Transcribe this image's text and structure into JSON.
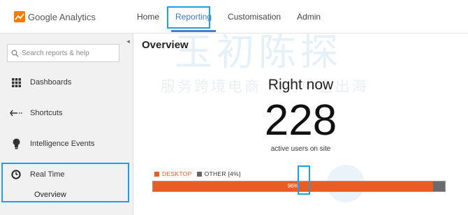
{
  "header": {
    "brand": "Google Analytics",
    "nav": [
      {
        "label": "Home",
        "active": false
      },
      {
        "label": "Reporting",
        "active": true
      },
      {
        "label": "Customisation",
        "active": false
      },
      {
        "label": "Admin",
        "active": false
      }
    ]
  },
  "sidebar": {
    "search_placeholder": "Search reports & help",
    "items": [
      {
        "label": "Dashboards",
        "icon": "grid-icon"
      },
      {
        "label": "Shortcuts",
        "icon": "shortcut-arrow-icon"
      },
      {
        "label": "Intelligence Events",
        "icon": "lightbulb-icon"
      },
      {
        "label": "Real Time",
        "icon": "clock-icon"
      }
    ],
    "subitems": [
      {
        "label": "Overview"
      }
    ]
  },
  "main": {
    "title": "Overview",
    "right_now": {
      "title": "Right now",
      "count": "228",
      "caption": "active users on site"
    },
    "legend": [
      {
        "label": "DESKTOP",
        "color": "#ec5b22"
      },
      {
        "label": "OTHER [4%]",
        "color": "#666666"
      }
    ],
    "device_bar": {
      "desktop_label": "96%",
      "desktop_fraction": 0.96,
      "other_fraction": 0.04
    }
  },
  "watermark": {
    "text": "服务跨境电商 助力中企出海",
    "logo_text": "玉初陈探"
  },
  "colors": {
    "accent": "#3f78c9",
    "desktop": "#ec5b22",
    "other": "#666666",
    "highlight": "#1f9ee0"
  }
}
